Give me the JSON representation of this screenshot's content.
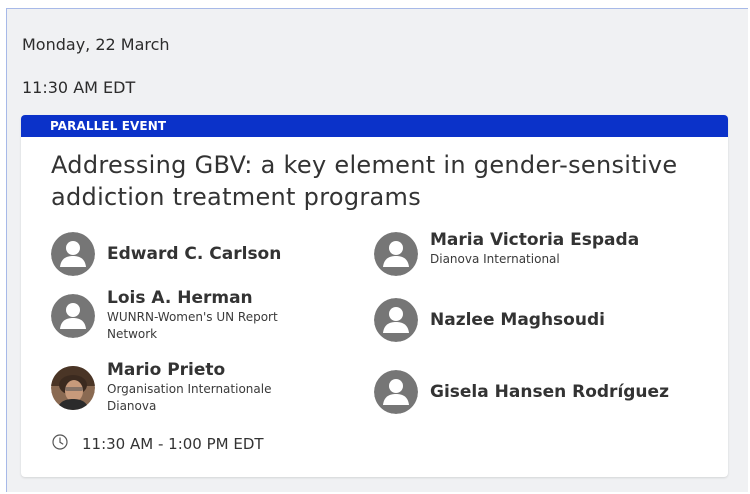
{
  "schedule": {
    "date": "Monday, 22 March",
    "time": "11:30 AM EDT"
  },
  "event": {
    "badge": "PARALLEL EVENT",
    "title": "Addressing GBV: a key element in gender-sensitive addiction treatment programs",
    "time_range": "11:30 AM - 1:00 PM EDT",
    "colors": {
      "banner": "#0b32c9",
      "avatar_placeholder": "#767676"
    },
    "speakers": [
      {
        "name": "Edward C. Carlson",
        "org": "",
        "avatar": "person-placeholder-icon"
      },
      {
        "name": "Maria Victoria Espada",
        "org": "Dianova International",
        "avatar": "person-placeholder-icon"
      },
      {
        "name": "Lois A. Herman",
        "org": "WUNRN-Women's UN Report Network",
        "avatar": "person-placeholder-icon"
      },
      {
        "name": "Nazlee Maghsoudi",
        "org": "",
        "avatar": "person-placeholder-icon"
      },
      {
        "name": "Mario Prieto",
        "org": "Organisation Internationale Dianova",
        "avatar": "photo"
      },
      {
        "name": "Gisela Hansen Rodríguez",
        "org": "",
        "avatar": "person-placeholder-icon"
      }
    ]
  }
}
